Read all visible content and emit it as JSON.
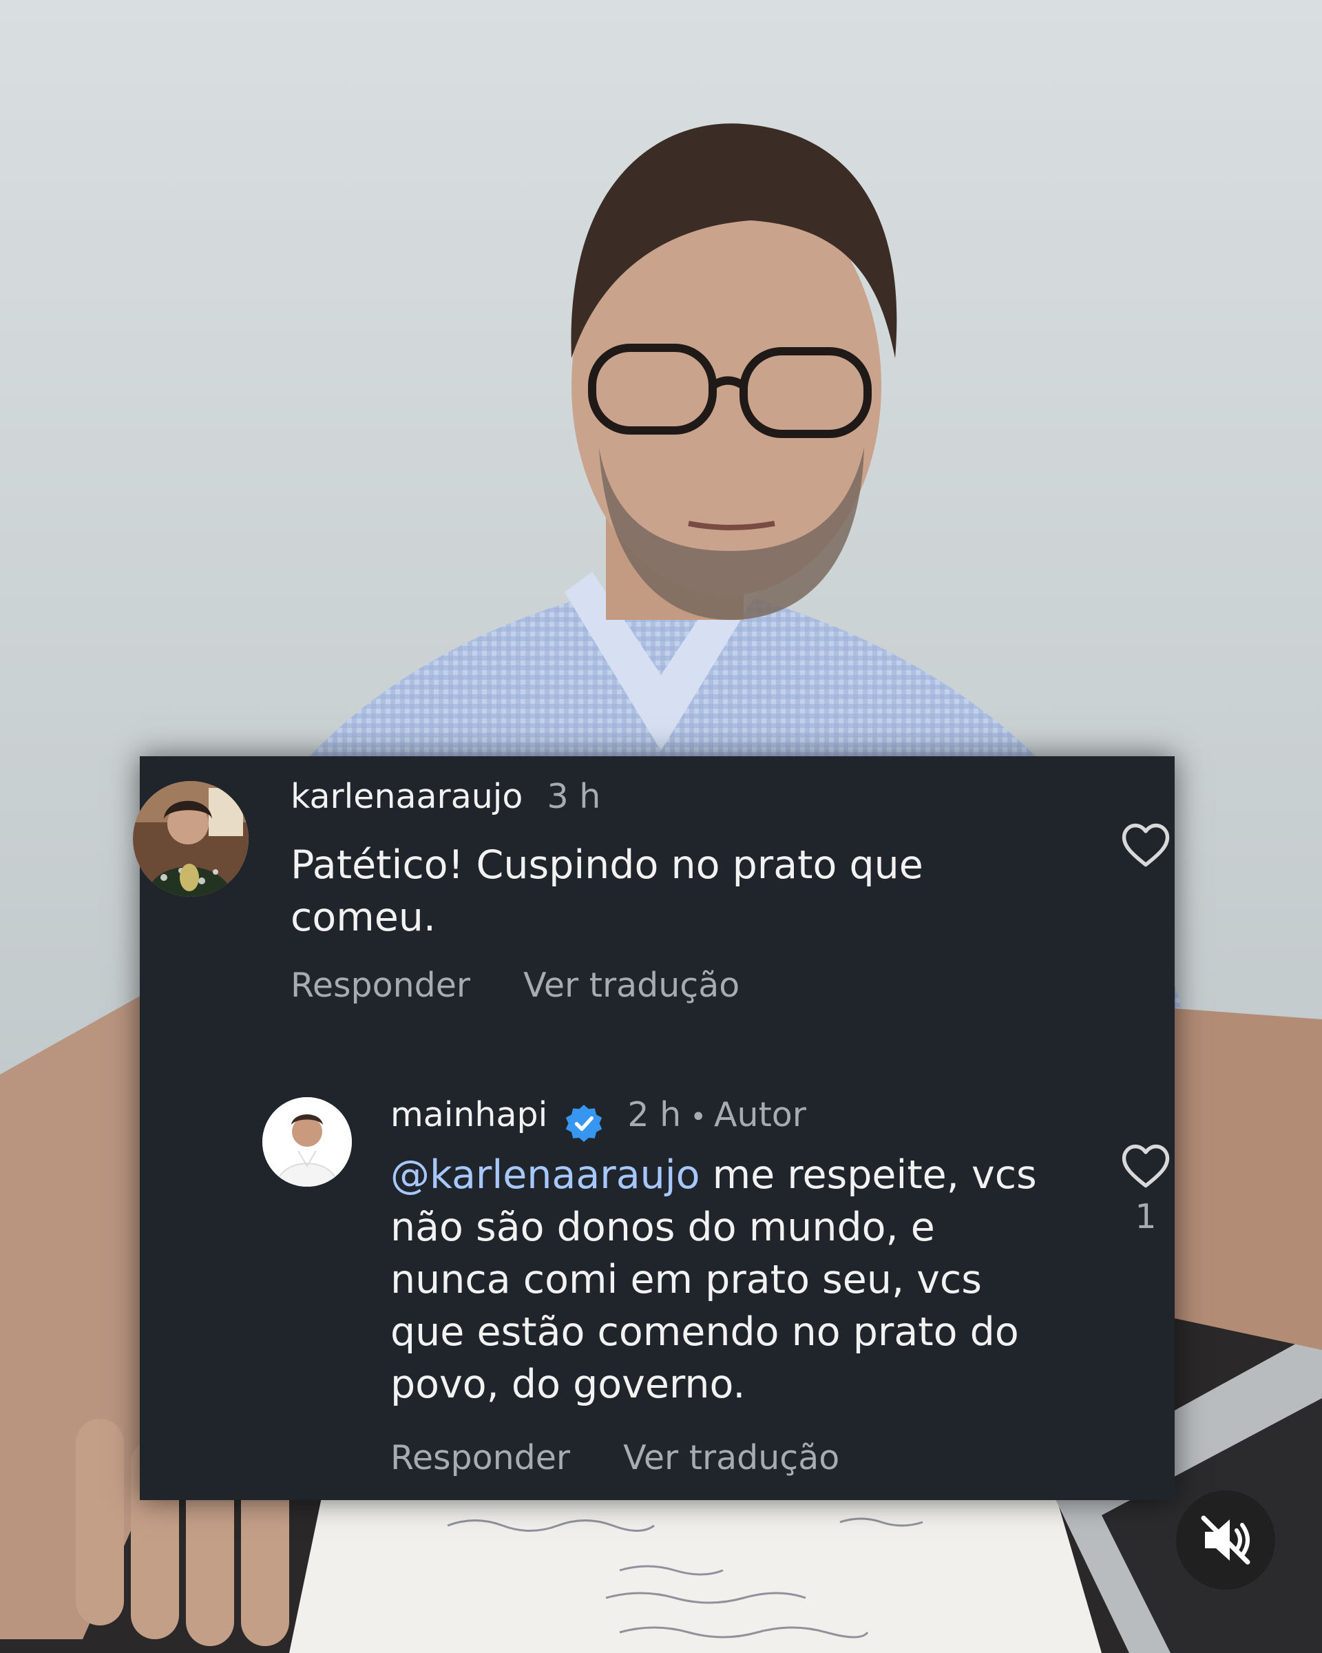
{
  "comments": [
    {
      "username": "karlenaaraujo",
      "time": "3 h",
      "text": "Patético! Cuspindo no prato que\ncomeu.",
      "reply_label": "Responder",
      "translate_label": "Ver tradução",
      "like_icon": "heart-outline-icon"
    }
  ],
  "reply": {
    "username": "mainhapi",
    "verified": true,
    "time": "2 h",
    "separator": "•",
    "author_label": "Autor",
    "mention": "@karlenaaraujo",
    "text": " me respeite, vcs\nnão são donos do mundo, e\nnunca comi em prato seu, vcs\nque estão comendo no prato do\npovo, do governo.",
    "reply_label": "Responder",
    "translate_label": "Ver tradução",
    "like_count": "1",
    "like_icon": "heart-outline-icon"
  },
  "controls": {
    "mute_icon": "speaker-muted-icon"
  },
  "colors": {
    "card_background": "#20242b",
    "mention": "#a6c8ff",
    "verified_badge": "#3797f0",
    "secondary_text": "#a8abb0"
  }
}
